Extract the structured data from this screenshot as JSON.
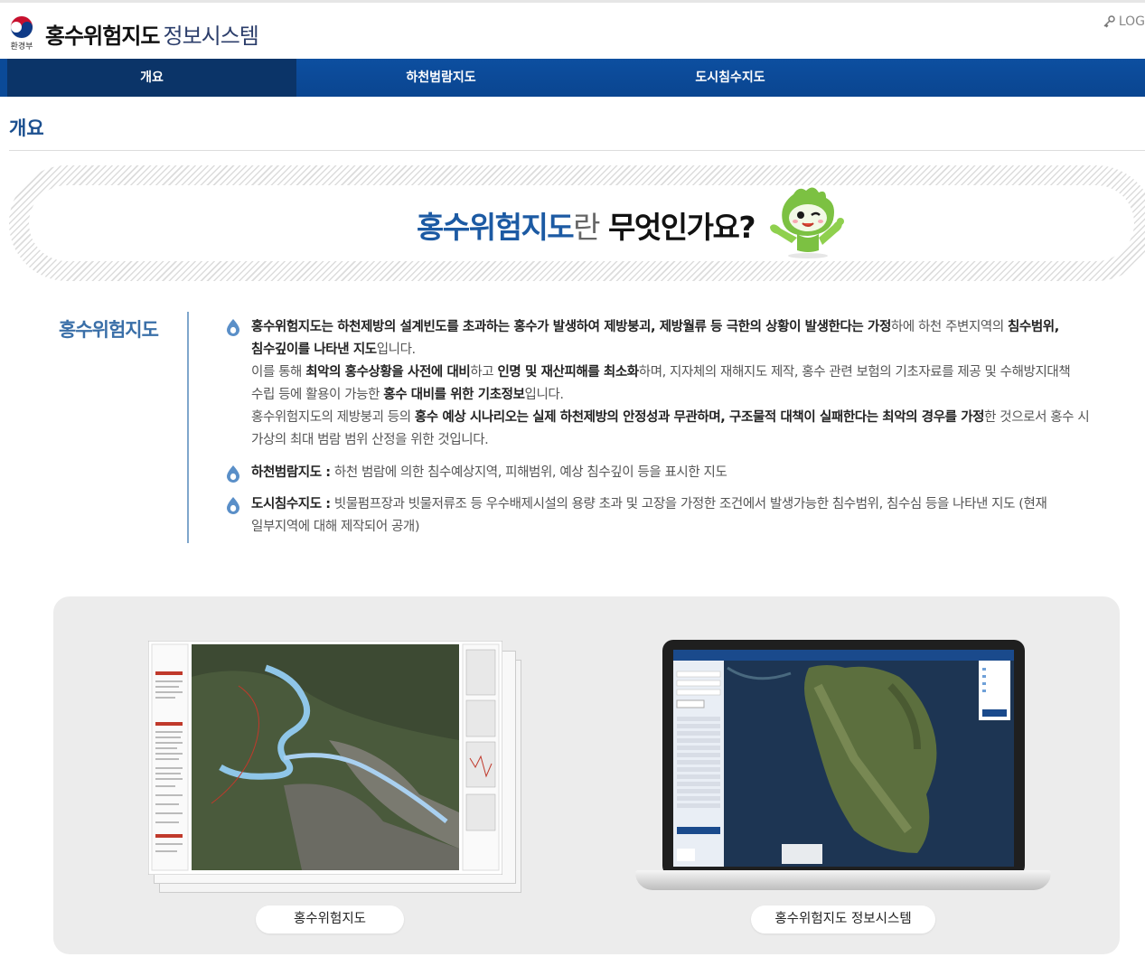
{
  "header": {
    "logo_label": "환경부",
    "title_bold": "홍수위험지도",
    "title_light": "정보시스템",
    "login_label": "LOG"
  },
  "nav": {
    "items": [
      {
        "label": "개요",
        "active": true
      },
      {
        "label": "하천범람지도",
        "active": false
      },
      {
        "label": "도시침수지도",
        "active": false
      }
    ]
  },
  "page_title": "개요",
  "banner": {
    "part1": "홍수위험지도",
    "part2": "란",
    "part3": "무엇인가요?"
  },
  "intro": {
    "section_label": "홍수위험지도",
    "p1": {
      "s1": "홍수위험지도는 하천제방의 설계빈도를 초과하는 홍수가 발생하여 제방붕괴, 제방월류 등 극한의 상황이 발생한다는 가정",
      "s2": "하에 하천 주변지역의 ",
      "s3": "침수범위,",
      "s4": "침수깊이를 나타낸 지도",
      "s5": "입니다."
    },
    "p2": {
      "s1": "이를 통해 ",
      "s2": "최악의 홍수상황을 사전에 대비",
      "s3": "하고 ",
      "s4": "인명 및 재산피해를 최소화",
      "s5": "하며, 지자체의 재해지도 제작, 홍수 관련 보험의 기초자료를 제공 및 수해방지대책",
      "s6": "수립 등에 활용이 가능한 ",
      "s7": "홍수 대비를 위한 기초정보",
      "s8": "입니다."
    },
    "p3": {
      "s1": "홍수위험지도의 제방붕괴 등의 ",
      "s2": "홍수 예상 시나리오는 실제 하천제방의 안정성과 무관하며, 구조물적 대책이 실패한다는 최악의 경우를 가정",
      "s3": "한 것으로서 홍수 시",
      "s4": "가상의 최대 범람 범위 산정을 위한 것입니다."
    },
    "item2": {
      "term": "하천범람지도 :",
      "desc": " 하천 범람에 의한 침수예상지역, 피해범위, 예상 침수깊이 등을 표시한 지도"
    },
    "item3": {
      "term": "도시침수지도 :",
      "desc1": " 빗물펌프장과 빗물저류조 등 우수배제시설의 용량 초과 및 고장을 가정한 조건에서 발생가능한 침수범위, 침수심 등을 나타낸 지도 (현재",
      "desc2": "일부지역에 대해 제작되어 공개)"
    }
  },
  "cards": [
    {
      "label": "홍수위험지도"
    },
    {
      "label": "홍수위험지도 정보시스템"
    }
  ],
  "colors": {
    "nav": "#0b4a98",
    "nav_active": "#0b3468",
    "accent": "#1c5aa3",
    "panel": "#ececec"
  }
}
